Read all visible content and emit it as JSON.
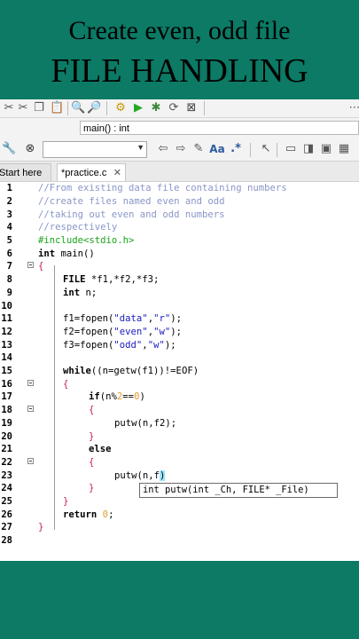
{
  "titles": {
    "line1": "Create even, odd file",
    "line2": "FILE HANDLING"
  },
  "toolbar": {
    "icons": [
      "scissors-icon",
      "copy-icon",
      "paste-icon",
      "find-icon",
      "replace-icon",
      "build-gear-icon",
      "run-icon",
      "build-run-icon",
      "rebuild-icon",
      "stop-icon"
    ]
  },
  "scope": {
    "function": "main() : int"
  },
  "search_toolbar": {
    "aa_label": "Aa",
    "regex_label": ".*"
  },
  "tabs": [
    {
      "label": "Start here",
      "close": ""
    },
    {
      "label": "*practice.c",
      "close": "✕"
    }
  ],
  "editor": {
    "line_numbers": [
      "1",
      "2",
      "3",
      "4",
      "5",
      "6",
      "7",
      "8",
      "9",
      "10",
      "11",
      "12",
      "13",
      "14",
      "15",
      "16",
      "17",
      "18",
      "19",
      "20",
      "21",
      "22",
      "23",
      "24",
      "25",
      "26",
      "27",
      "28"
    ],
    "tooltip": "int putw(int _Ch, FILE* _File)"
  },
  "code": {
    "l1": "//From existing data file containing numbers",
    "l2": "//create files named even and odd",
    "l3": "//taking out even and odd numbers",
    "l4": "//respectively",
    "l5": "#include<stdio.h>",
    "l6_kw": "int",
    "l6_rest": " main()",
    "l7": "{",
    "l8_kw": "FILE",
    "l8_rest": " *f1,*f2,*f3;",
    "l9_kw": "int",
    "l9_rest": " n;",
    "l11a": "f1=fopen(",
    "l11s1": "\"data\"",
    "l11c": ",",
    "l11s2": "\"r\"",
    "l11e": ");",
    "l12a": "f2=fopen(",
    "l12s1": "\"even\"",
    "l12c": ",",
    "l12s2": "\"w\"",
    "l12e": ");",
    "l13a": "f3=fopen(",
    "l13s1": "\"odd\"",
    "l13c": ",",
    "l13s2": "\"w\"",
    "l13e": ");",
    "l15_kw": "while",
    "l15_rest": "((n=getw(f1))!=EOF)",
    "l16": "{",
    "l17_kw": "if",
    "l17_a": "(n%",
    "l17_n": "2",
    "l17_b": "==",
    "l17_n2": "0",
    "l17_c": ")",
    "l18": "{",
    "l19": "putw(n,f2);",
    "l20": "}",
    "l21_kw": "else",
    "l22": "{",
    "l23a": "putw(",
    "l23b": "n,f",
    "l23c": ")",
    "l24": "}",
    "l25": "}",
    "l26_kw": "return",
    "l26_n": "0",
    "l26_e": ";",
    "l27": "}"
  },
  "colors": {
    "background": "#0c7a65",
    "comment": "#8a96c8",
    "preprocessor": "#1aa31a",
    "string": "#1a1ac0",
    "number": "#e0a030"
  }
}
